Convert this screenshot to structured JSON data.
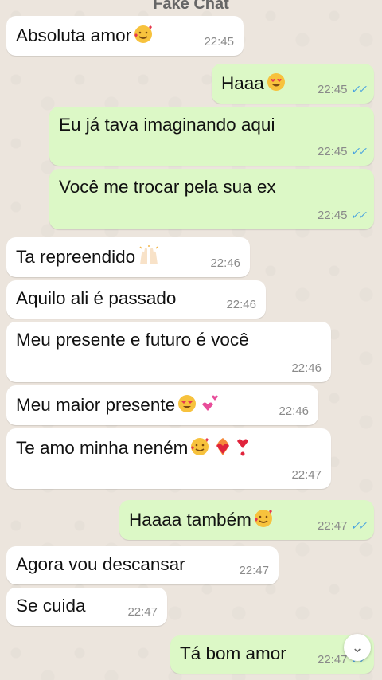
{
  "header": {
    "title": "Fake Chat"
  },
  "messages": [
    {
      "text": "Absoluta amor",
      "emoji": "smiling-face-with-hearts",
      "time": "22:45",
      "dir": "in"
    },
    {
      "text": "Haaa",
      "emoji": "heart-eyes",
      "time": "22:45",
      "dir": "out",
      "status": "read"
    },
    {
      "text": "Eu já tava imaginando aqui",
      "time": "22:45",
      "dir": "out",
      "status": "read"
    },
    {
      "text": "Você me trocar pela sua ex",
      "time": "22:45",
      "dir": "out",
      "status": "read"
    },
    {
      "text": "Ta repreendido",
      "emoji": "raising-hands",
      "time": "22:46",
      "dir": "in"
    },
    {
      "text": "Aquilo ali é passado",
      "time": "22:46",
      "dir": "in"
    },
    {
      "text": "Meu presente e futuro é você",
      "time": "22:46",
      "dir": "in"
    },
    {
      "text": "Meu maior presente",
      "emoji": "heart-eyes, two-hearts",
      "time": "22:46",
      "dir": "in"
    },
    {
      "text": "Te amo minha neném",
      "emoji": "smiling-face-with-hearts, heart-on-fire, heart-exclamation",
      "time": "22:47",
      "dir": "in"
    },
    {
      "text": "Haaaa também",
      "emoji": "smiling-face-with-hearts",
      "time": "22:47",
      "dir": "out",
      "status": "read"
    },
    {
      "text": "Agora vou descansar",
      "time": "22:47",
      "dir": "in"
    },
    {
      "text": "Se cuida",
      "time": "22:47",
      "dir": "in"
    },
    {
      "text": "Tá bom amor",
      "time": "22:47",
      "dir": "out",
      "status": "read"
    }
  ],
  "read_tick": "✓✓",
  "scroll_button": {
    "icon": "chevron-double-down-icon",
    "glyph": "⌄"
  },
  "colors": {
    "incoming": "#ffffff",
    "outgoing": "#dcf8c6",
    "tick": "#4aa3df",
    "background": "#ece5dd"
  }
}
